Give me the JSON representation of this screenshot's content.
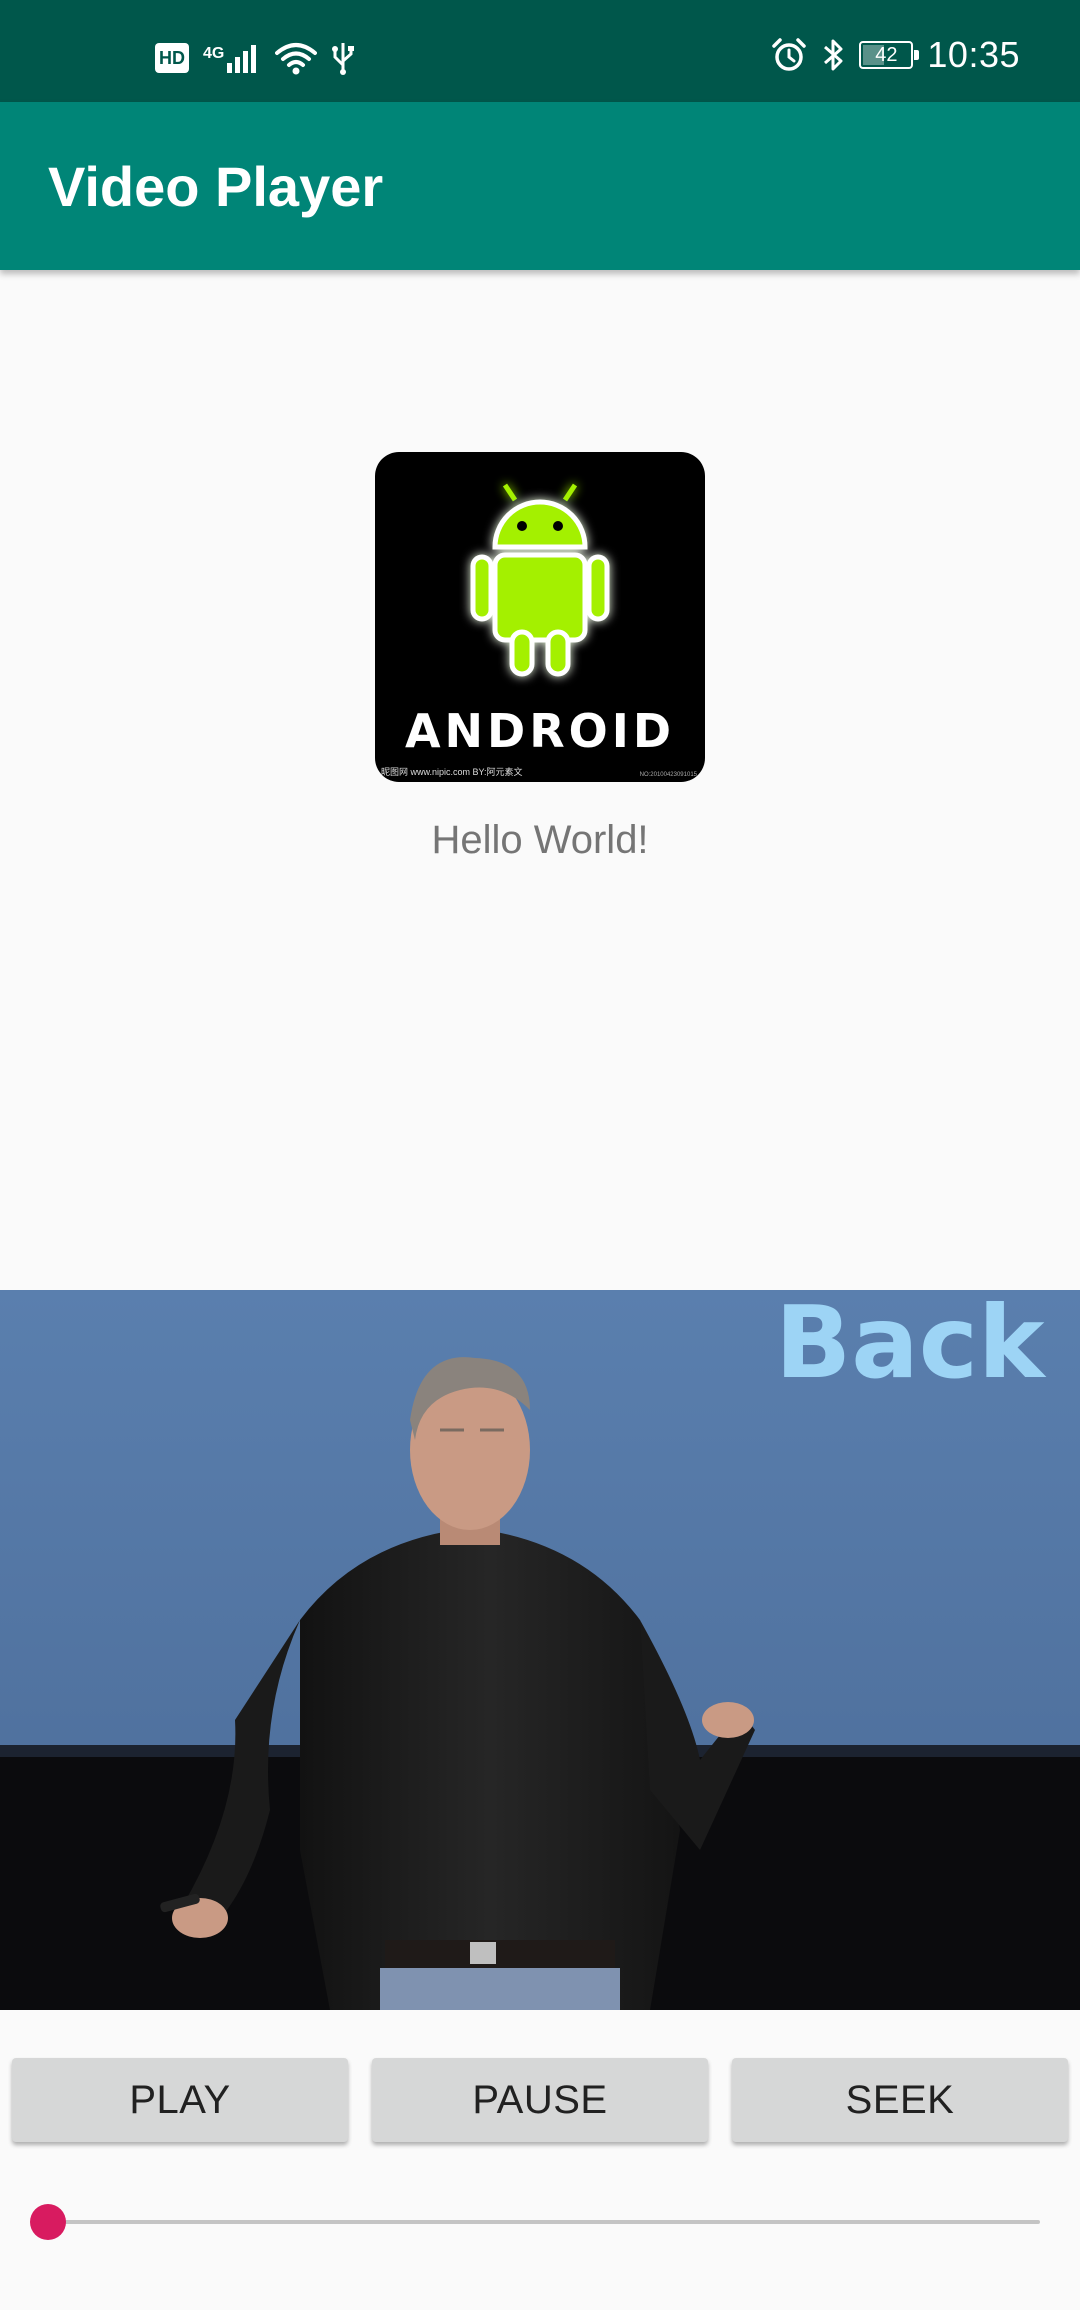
{
  "status_bar": {
    "left_icons": [
      "hd-icon",
      "signal-4g-icon",
      "wifi-icon",
      "usb-icon"
    ],
    "hd_label": "HD",
    "network_label": "4G",
    "right_icons": [
      "alarm-icon",
      "bluetooth-icon",
      "battery-icon"
    ],
    "battery_level": "42",
    "battery_fraction": 0.42,
    "time": "10:35"
  },
  "app_bar": {
    "title": "Video Player"
  },
  "logo": {
    "wordmark": "ANDROID",
    "credit_left": "昵图网 www.nipic.com  BY:阿元素文",
    "credit_right": "NO:20100423091015"
  },
  "main": {
    "hello_text": "Hello World!"
  },
  "video": {
    "slide_text": "Back t"
  },
  "controls": {
    "play_label": "PLAY",
    "pause_label": "PAUSE",
    "seek_label": "SEEK"
  },
  "seekbar": {
    "progress": 0.0
  },
  "colors": {
    "status_bar": "#00574b",
    "app_bar": "#008577",
    "accent": "#d81b60",
    "android_green": "#a4f000"
  }
}
